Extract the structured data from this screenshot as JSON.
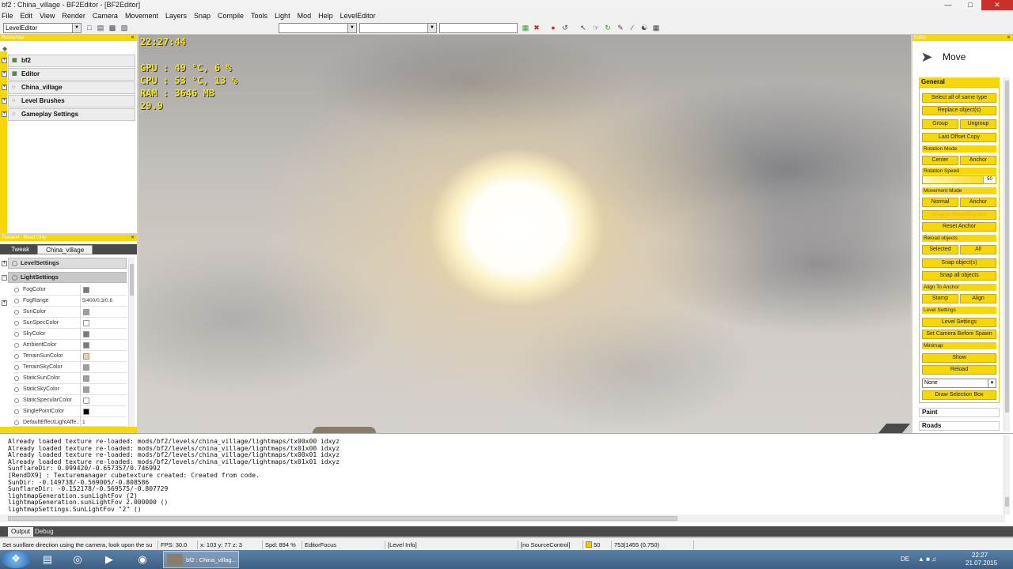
{
  "window": {
    "title": "bf2 : China_village - BF2Editor - [BF2Editor]"
  },
  "menu": [
    "File",
    "Edit",
    "View",
    "Render",
    "Camera",
    "Movement",
    "Layers",
    "Snap",
    "Compile",
    "Tools",
    "Light",
    "Mod",
    "Help",
    "LevelEditor"
  ],
  "toolbar": {
    "editor_select": "LevelEditor"
  },
  "resources": {
    "header": "Resources",
    "items": [
      "bf2",
      "Editor",
      "China_village",
      "Level Brushes",
      "Gameplay Settings"
    ]
  },
  "tweaker": {
    "header": "Tweaker - Read Only",
    "tabs": [
      "Tweak",
      "China_village"
    ],
    "sections": [
      "LevelSettings",
      "LightSettings"
    ],
    "props": [
      {
        "name": "FogColor",
        "color": "#7a7a7a"
      },
      {
        "name": "FogRange",
        "value": "5/400/0.3/0.6"
      },
      {
        "name": "SunColor",
        "color": "#a0a0a0"
      },
      {
        "name": "SunSpecColor",
        "color": "#ffffff"
      },
      {
        "name": "SkyColor",
        "color": "#7a7a7a"
      },
      {
        "name": "AmbientColor",
        "color": "#7a7a7a"
      },
      {
        "name": "TerrainSunColor",
        "color": "#f2cfa0"
      },
      {
        "name": "TerrainSkyColor",
        "color": "#a0a0a0"
      },
      {
        "name": "StaticSunColor",
        "color": "#a0a0a0"
      },
      {
        "name": "StaticSkyColor",
        "color": "#a0a0a0"
      },
      {
        "name": "StaticSpecularColor",
        "color": "#ffffff"
      },
      {
        "name": "SinglePointColor",
        "color": "#000000"
      },
      {
        "name": "DefaultEffectLightAffe...",
        "value": "1"
      }
    ]
  },
  "hud": {
    "time": "22:27:44",
    "gpu": "GPU  : 49 °C, 6 %",
    "cpu": "CPU  : 53 °C, 13 %",
    "ram": "RAM  : 3646 MB",
    "fps": "29.9"
  },
  "editor": {
    "header": "Editor",
    "mode": "Move",
    "general": "General",
    "buttons": {
      "select_all_type": "Select all of same type",
      "replace": "Replace object(s)",
      "group": "Group",
      "ungroup": "Ungroup",
      "last_offset": "Last Offset Copy",
      "rot_center": "Center",
      "rot_anchor": "Anchor",
      "move_normal": "Normal",
      "move_anchor": "Anchor",
      "snap_bbox": "Snap to Bounding Box",
      "reset_anchor": "Reset Anchor",
      "reload_selected": "Selected",
      "reload_all": "All",
      "snap_objects": "Snap object(s)",
      "snap_all": "Snap all objects",
      "align_stamp": "Stamp",
      "align_align": "Align",
      "level_settings": "Level Settings",
      "set_camera": "Set Camera Before Spawn",
      "minimap_show": "Show",
      "minimap_reload": "Reload",
      "draw_bbox": "Draw Selection Box"
    },
    "labels": {
      "rotation_mode": "Rotation Mode",
      "rotation_speed": "Rotation Speed",
      "movement_mode": "Movement Mode",
      "reload_objects": "Reload objects",
      "align_to_anchor": "Align To Anchor",
      "level_settings": "Level Settings",
      "minimap": "Minimap"
    },
    "rotation_speed_value": "50",
    "dropdown_value": "None",
    "paint": "Paint",
    "roads": "Roads"
  },
  "output": {
    "lines": [
      "Already loaded texture re-loaded: mods/bf2/levels/china_village/lightmaps/tx00x00 idxyz",
      "Already loaded texture re-loaded: mods/bf2/levels/china_village/lightmaps/tx01x00 idxyz",
      "Already loaded texture re-loaded: mods/bf2/levels/china_village/lightmaps/tx00x01 idxyz",
      "Already loaded texture re-loaded: mods/bf2/levels/china_village/lightmaps/tx01x01 idxyz",
      "SunflareDir: 0.099420/-0.657357/0.746992",
      "[RendDX9] : Texturemanager cubetexture created: Created from code.",
      "SunDir: -0.149738/-0.569005/-0.808586",
      "SunflareDir: -0.152178/-0.569575/-0.807729",
      "lightmapGeneration.sunLightFov (2)",
      "lightmapGeneration.sunLightFov 2.000000 ()",
      "lightmapSettings.SunLightFov \"2\" ()"
    ],
    "tabs": [
      "Output",
      "Debug"
    ]
  },
  "status": {
    "hint": "Set sunflare direction using the camera, look upon the su",
    "fps": "FPS: 30.0",
    "coords": "x: 103 y: 77 z: 3",
    "speed": "Spd: 894 %",
    "focus": "EditorFocus",
    "level_info": "[Level Info]",
    "source_control": "[no SourceControl]",
    "count": "50",
    "mem": "753|1455 (0.750)"
  },
  "taskbar": {
    "window_label": "bf2 : China_villag...",
    "lang": "DE",
    "time": "22:27",
    "date": "21.07.2015"
  }
}
